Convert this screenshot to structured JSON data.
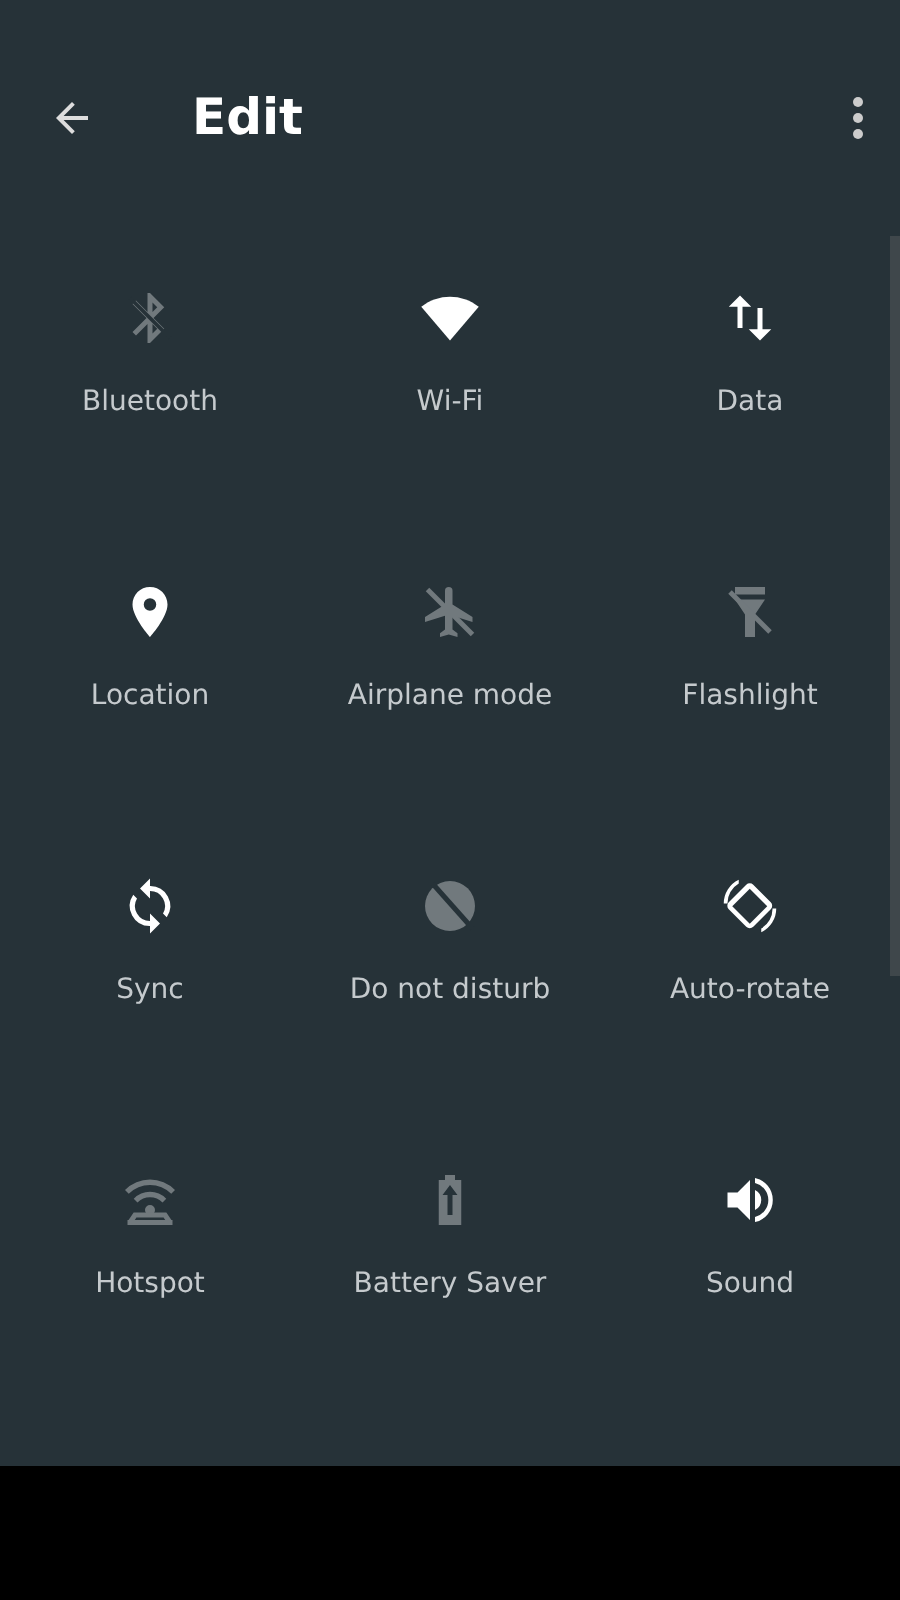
{
  "header": {
    "title": "Edit"
  },
  "tiles": [
    {
      "label": "Bluetooth",
      "kind": "bluetooth",
      "on": false
    },
    {
      "label": "Wi-Fi",
      "kind": "wifi",
      "on": true
    },
    {
      "label": "Data",
      "kind": "data",
      "on": true
    },
    {
      "label": "Location",
      "kind": "location",
      "on": true
    },
    {
      "label": "Airplane mode",
      "kind": "airplane",
      "on": false
    },
    {
      "label": "Flashlight",
      "kind": "flashlight",
      "on": false
    },
    {
      "label": "Sync",
      "kind": "sync",
      "on": true
    },
    {
      "label": "Do not disturb",
      "kind": "dnd",
      "on": false
    },
    {
      "label": "Auto-rotate",
      "kind": "rotate",
      "on": true
    },
    {
      "label": "Hotspot",
      "kind": "hotspot",
      "on": false
    },
    {
      "label": "Battery Saver",
      "kind": "battery",
      "on": false
    },
    {
      "label": "Sound",
      "kind": "sound",
      "on": true
    }
  ]
}
